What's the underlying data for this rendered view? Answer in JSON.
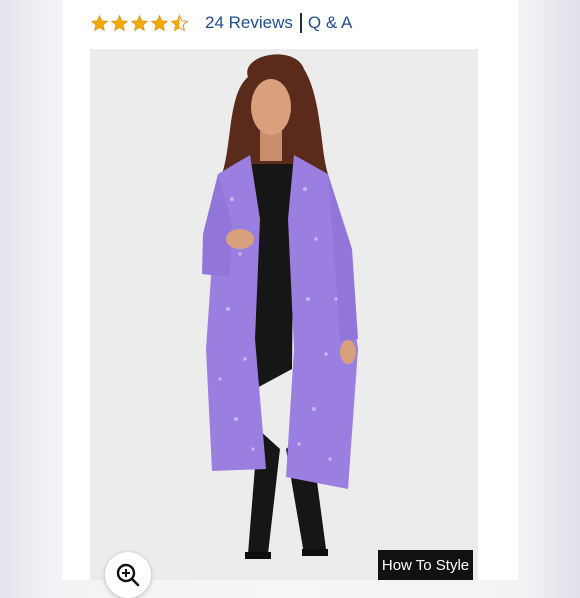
{
  "product": {
    "rating": 4.5,
    "rating_max": 5,
    "reviews_link": "24 Reviews",
    "qa_link": "Q & A"
  },
  "image": {
    "alt": "Woman wearing a long lavender sequin cardigan over a black top and black pants"
  },
  "buttons": {
    "how_to_style": "How To Style"
  },
  "icons": {
    "star": "star-icon",
    "zoom": "zoom-in-icon"
  },
  "colors": {
    "star": "#f2a900",
    "link": "#1f4e8c",
    "cardigan": "#9b7fe0",
    "button_bg": "#111111"
  }
}
